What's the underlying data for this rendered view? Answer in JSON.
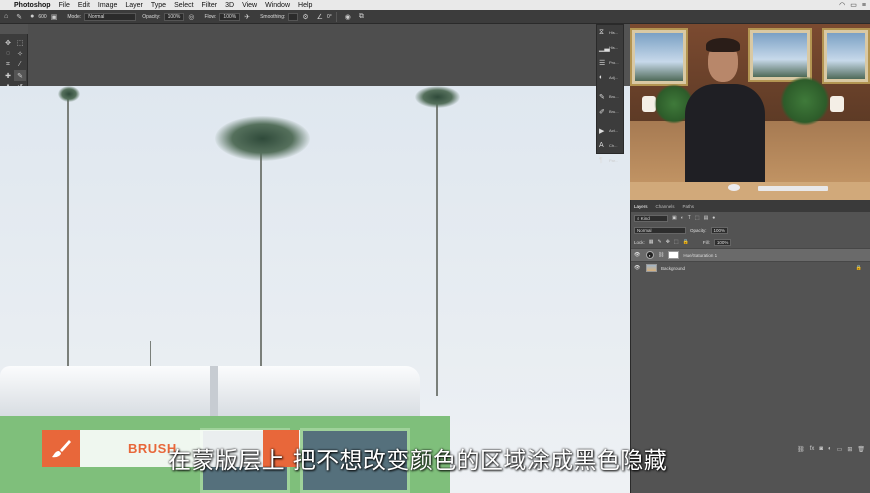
{
  "menubar": {
    "app_name": "Photoshop",
    "items": [
      "File",
      "Edit",
      "Image",
      "Layer",
      "Type",
      "Select",
      "Filter",
      "3D",
      "View",
      "Window",
      "Help"
    ]
  },
  "options_bar": {
    "brush_size": "600",
    "mode_label": "Mode:",
    "mode_value": "Normal",
    "opacity_label": "Opacity:",
    "opacity_value": "100%",
    "flow_label": "Flow:",
    "flow_value": "100%",
    "smoothing_label": "Smoothing:",
    "angle_value": "0°"
  },
  "float_panel": {
    "items": [
      {
        "icon": "history-icon",
        "label": "His..."
      },
      {
        "icon": "histogram-icon",
        "label": "His..."
      },
      {
        "icon": "properties-icon",
        "label": "Pro..."
      },
      {
        "icon": "adjustments-icon",
        "label": "Adj..."
      },
      {
        "icon": "brush-settings-icon",
        "label": "Bru..."
      },
      {
        "icon": "brushes-icon",
        "label": "Bru..."
      },
      {
        "icon": "actions-icon",
        "label": "Act..."
      },
      {
        "icon": "character-icon",
        "label": "Ch..."
      },
      {
        "icon": "paragraph-icon",
        "label": "Par..."
      }
    ]
  },
  "layers_panel": {
    "tabs": [
      "Layers",
      "Channels",
      "Paths"
    ],
    "active_tab": "Layers",
    "filter_kind": "Kind",
    "blend_mode": "Normal",
    "opacity_label": "Opacity:",
    "opacity_value": "100%",
    "lock_label": "Lock:",
    "fill_label": "Fill:",
    "fill_value": "100%",
    "layers": [
      {
        "name": "Hue/Saturation 1",
        "type": "adjustment",
        "selected": true
      },
      {
        "name": "Background",
        "type": "image",
        "selected": false
      }
    ]
  },
  "overlay": {
    "brush_label": "BRUSH",
    "subtitle": "在蒙版层上 把不想改变颜色的区域涂成黑色隐藏"
  }
}
